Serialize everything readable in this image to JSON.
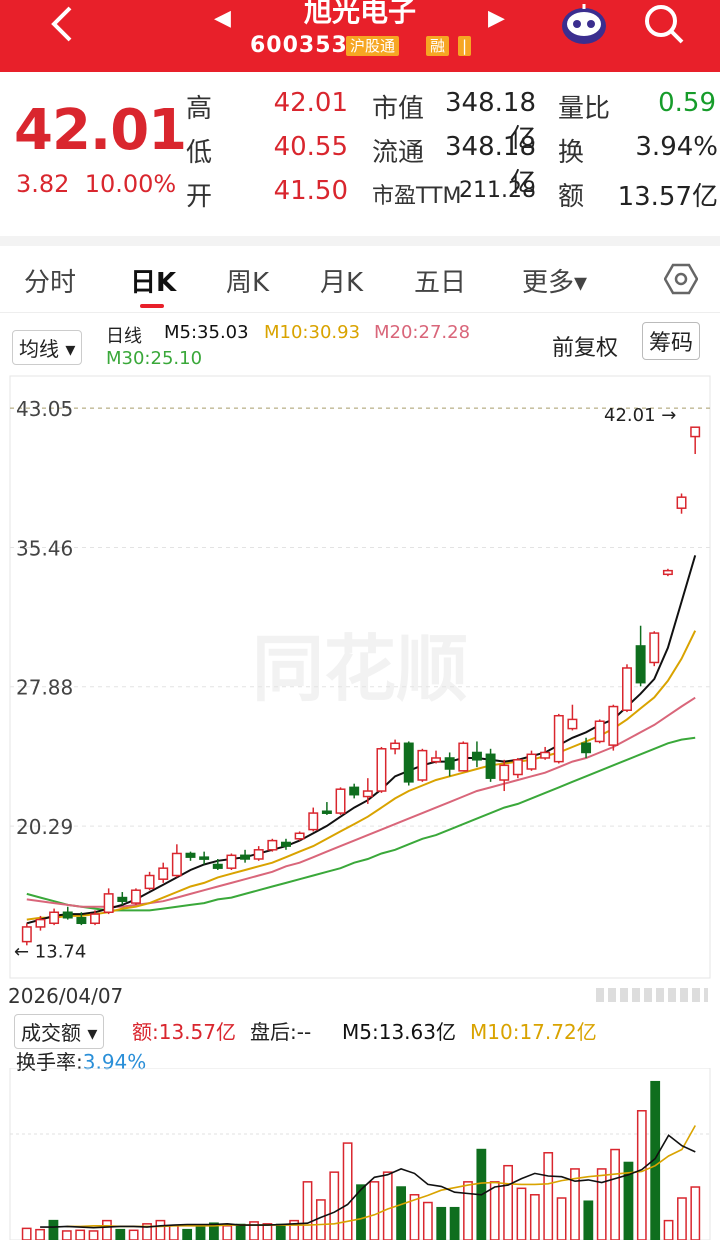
{
  "header": {
    "title": "旭光电子",
    "code": "600353",
    "tag1": "沪股通",
    "tag2": "融",
    "tag3": "|"
  },
  "quote": {
    "price": "42.01",
    "change": "3.82",
    "change_pct": "10.00%",
    "high_label": "高",
    "high": "42.01",
    "low_label": "低",
    "low": "40.55",
    "open_label": "开",
    "open": "41.50",
    "mcap_label": "市值",
    "mcap": "348.18亿",
    "float_label": "流通",
    "float": "348.18亿",
    "pe_label": "市盈TTM",
    "pe": "211.28",
    "vr_label": "量比",
    "vr": "0.59",
    "turn_label": "换",
    "turn": "3.94%",
    "amt_label": "额",
    "amt": "13.57亿"
  },
  "tabs": [
    "分时",
    "日K",
    "周K",
    "月K",
    "五日",
    "更多▾"
  ],
  "indicator": {
    "selector": "均线",
    "period": "日线",
    "m5": "M5:35.03",
    "m10": "M10:30.93",
    "m20": "M20:27.28",
    "m30": "M30:25.10",
    "adjust": "前复权",
    "chips": "筹码"
  },
  "axis": {
    "y_labels": [
      "43.05",
      "35.46",
      "27.88",
      "20.29"
    ],
    "max_label": "42.01",
    "min_label": "13.74",
    "date": "2026/04/07",
    "watermark": "同花顺"
  },
  "volume": {
    "selector": "成交额",
    "amt": "额:13.57亿",
    "after": "盘后:--",
    "m5": "M5:13.63亿",
    "m10": "M10:17.72亿",
    "turn_label": "换手率:",
    "turn": "3.94%"
  },
  "colors": {
    "up": "#d9262e",
    "down": "#0f6e1e",
    "m5": "#111111",
    "m10": "#d9a300",
    "m20": "#d9667a",
    "m30": "#3aa83a"
  },
  "chart_data": {
    "type": "candlestick",
    "y_ticks": [
      43.05,
      35.46,
      27.88,
      20.29
    ],
    "ylim": [
      13.0,
      43.6
    ],
    "candles": [
      {
        "o": 14.0,
        "c": 14.8,
        "h": 15.0,
        "l": 13.8
      },
      {
        "o": 14.8,
        "c": 15.2,
        "h": 15.4,
        "l": 14.6
      },
      {
        "o": 15.0,
        "c": 15.6,
        "h": 15.8,
        "l": 14.9
      },
      {
        "o": 15.6,
        "c": 15.3,
        "h": 15.9,
        "l": 15.2
      },
      {
        "o": 15.3,
        "c": 15.0,
        "h": 15.6,
        "l": 14.9
      },
      {
        "o": 15.0,
        "c": 15.5,
        "h": 15.7,
        "l": 14.9
      },
      {
        "o": 15.6,
        "c": 16.6,
        "h": 16.9,
        "l": 15.5
      },
      {
        "o": 16.4,
        "c": 16.2,
        "h": 16.7,
        "l": 16.0
      },
      {
        "o": 16.1,
        "c": 16.8,
        "h": 16.9,
        "l": 16.0
      },
      {
        "o": 16.9,
        "c": 17.6,
        "h": 17.8,
        "l": 16.8
      },
      {
        "o": 17.4,
        "c": 18.0,
        "h": 18.3,
        "l": 17.2
      },
      {
        "o": 17.6,
        "c": 18.8,
        "h": 19.3,
        "l": 17.5
      },
      {
        "o": 18.8,
        "c": 18.6,
        "h": 18.9,
        "l": 18.4
      },
      {
        "o": 18.6,
        "c": 18.5,
        "h": 18.9,
        "l": 18.2
      },
      {
        "o": 18.2,
        "c": 18.0,
        "h": 18.5,
        "l": 17.9
      },
      {
        "o": 18.0,
        "c": 18.7,
        "h": 18.8,
        "l": 17.9
      },
      {
        "o": 18.7,
        "c": 18.5,
        "h": 19.0,
        "l": 18.3
      },
      {
        "o": 18.5,
        "c": 19.0,
        "h": 19.2,
        "l": 18.4
      },
      {
        "o": 19.0,
        "c": 19.5,
        "h": 19.6,
        "l": 18.9
      },
      {
        "o": 19.4,
        "c": 19.2,
        "h": 19.6,
        "l": 19.0
      },
      {
        "o": 19.6,
        "c": 19.9,
        "h": 20.0,
        "l": 19.5
      },
      {
        "o": 20.1,
        "c": 21.0,
        "h": 21.3,
        "l": 20.0
      },
      {
        "o": 21.1,
        "c": 21.0,
        "h": 21.6,
        "l": 20.9
      },
      {
        "o": 21.0,
        "c": 22.3,
        "h": 22.4,
        "l": 20.9
      },
      {
        "o": 22.4,
        "c": 22.0,
        "h": 22.6,
        "l": 21.8
      },
      {
        "o": 21.9,
        "c": 22.2,
        "h": 22.9,
        "l": 21.5
      },
      {
        "o": 22.2,
        "c": 24.5,
        "h": 24.6,
        "l": 22.1
      },
      {
        "o": 24.5,
        "c": 24.8,
        "h": 25.0,
        "l": 24.2
      },
      {
        "o": 24.8,
        "c": 22.7,
        "h": 24.9,
        "l": 22.5
      },
      {
        "o": 22.8,
        "c": 24.4,
        "h": 24.5,
        "l": 22.7
      },
      {
        "o": 23.8,
        "c": 24.0,
        "h": 24.4,
        "l": 23.7
      },
      {
        "o": 24.0,
        "c": 23.4,
        "h": 24.3,
        "l": 23.0
      },
      {
        "o": 23.3,
        "c": 24.8,
        "h": 24.9,
        "l": 23.3
      },
      {
        "o": 24.3,
        "c": 23.9,
        "h": 24.9,
        "l": 23.5
      },
      {
        "o": 24.2,
        "c": 22.9,
        "h": 24.5,
        "l": 22.7
      },
      {
        "o": 22.8,
        "c": 23.6,
        "h": 23.9,
        "l": 22.2
      },
      {
        "o": 23.1,
        "c": 23.9,
        "h": 24.0,
        "l": 22.9
      },
      {
        "o": 23.4,
        "c": 24.2,
        "h": 24.4,
        "l": 23.3
      },
      {
        "o": 24.0,
        "c": 24.3,
        "h": 24.6,
        "l": 23.9
      },
      {
        "o": 23.8,
        "c": 26.3,
        "h": 26.4,
        "l": 23.7
      },
      {
        "o": 25.6,
        "c": 26.1,
        "h": 26.9,
        "l": 25.5
      },
      {
        "o": 24.8,
        "c": 24.3,
        "h": 25.1,
        "l": 24.0
      },
      {
        "o": 24.9,
        "c": 26.0,
        "h": 26.1,
        "l": 24.8
      },
      {
        "o": 24.7,
        "c": 26.8,
        "h": 26.9,
        "l": 24.4
      },
      {
        "o": 26.6,
        "c": 28.9,
        "h": 29.1,
        "l": 26.5
      },
      {
        "o": 30.1,
        "c": 28.1,
        "h": 31.2,
        "l": 27.9
      },
      {
        "o": 29.2,
        "c": 30.8,
        "h": 30.9,
        "l": 29.0
      },
      {
        "o": 34.0,
        "c": 34.2,
        "h": 34.3,
        "l": 33.9
      },
      {
        "o": 37.6,
        "c": 38.2,
        "h": 38.4,
        "l": 37.3
      },
      {
        "o": 41.5,
        "c": 42.01,
        "h": 42.01,
        "l": 40.55
      }
    ],
    "ma5": [
      15.0,
      15.2,
      15.4,
      15.5,
      15.5,
      15.6,
      15.8,
      16.0,
      16.3,
      16.7,
      17.1,
      17.5,
      17.9,
      18.2,
      18.4,
      18.5,
      18.6,
      18.8,
      19.0,
      19.2,
      19.5,
      19.9,
      20.3,
      20.8,
      21.3,
      21.7,
      22.3,
      23.0,
      23.3,
      23.6,
      23.8,
      23.8,
      24.0,
      24.0,
      23.9,
      23.8,
      23.9,
      24.1,
      24.3,
      24.7,
      25.1,
      25.4,
      25.8,
      26.1,
      26.8,
      27.5,
      28.3,
      30.0,
      32.5,
      35.03
    ],
    "ma10": [
      15.2,
      15.3,
      15.3,
      15.4,
      15.4,
      15.5,
      15.6,
      15.8,
      15.9,
      16.1,
      16.4,
      16.7,
      17.0,
      17.2,
      17.5,
      17.7,
      17.9,
      18.1,
      18.3,
      18.6,
      18.9,
      19.2,
      19.6,
      20.0,
      20.4,
      20.8,
      21.3,
      21.8,
      22.2,
      22.5,
      22.8,
      23.0,
      23.2,
      23.4,
      23.6,
      23.7,
      23.8,
      23.9,
      24.1,
      24.3,
      24.6,
      24.9,
      25.2,
      25.6,
      26.1,
      26.7,
      27.3,
      28.2,
      29.4,
      30.93
    ],
    "ma20": [
      16.3,
      16.2,
      16.1,
      16.0,
      15.9,
      15.9,
      15.9,
      15.9,
      16.0,
      16.1,
      16.2,
      16.4,
      16.6,
      16.8,
      17.0,
      17.2,
      17.4,
      17.6,
      17.8,
      18.1,
      18.3,
      18.6,
      18.9,
      19.2,
      19.5,
      19.8,
      20.1,
      20.4,
      20.7,
      21.0,
      21.3,
      21.6,
      21.9,
      22.2,
      22.4,
      22.6,
      22.8,
      23.0,
      23.2,
      23.5,
      23.8,
      24.0,
      24.3,
      24.6,
      25.0,
      25.4,
      25.8,
      26.3,
      26.8,
      27.28
    ],
    "ma30": [
      16.6,
      16.4,
      16.2,
      16.0,
      15.9,
      15.8,
      15.7,
      15.7,
      15.7,
      15.7,
      15.8,
      15.9,
      16.0,
      16.1,
      16.3,
      16.4,
      16.6,
      16.8,
      17.0,
      17.2,
      17.4,
      17.6,
      17.8,
      18.0,
      18.3,
      18.5,
      18.8,
      19.0,
      19.3,
      19.6,
      19.8,
      20.1,
      20.4,
      20.7,
      21.0,
      21.3,
      21.5,
      21.8,
      22.1,
      22.4,
      22.7,
      23.0,
      23.3,
      23.6,
      23.9,
      24.2,
      24.5,
      24.8,
      25.0,
      25.1
    ],
    "volume": [
      {
        "v": 1.8,
        "up": true
      },
      {
        "v": 1.6,
        "up": true
      },
      {
        "v": 3.0,
        "up": false
      },
      {
        "v": 1.4,
        "up": true
      },
      {
        "v": 1.5,
        "up": true
      },
      {
        "v": 1.4,
        "up": true
      },
      {
        "v": 3.0,
        "up": true
      },
      {
        "v": 1.6,
        "up": false
      },
      {
        "v": 1.5,
        "up": true
      },
      {
        "v": 2.5,
        "up": true
      },
      {
        "v": 3.0,
        "up": true
      },
      {
        "v": 2.2,
        "up": true
      },
      {
        "v": 1.6,
        "up": false
      },
      {
        "v": 2.0,
        "up": false
      },
      {
        "v": 2.6,
        "up": false
      },
      {
        "v": 2.2,
        "up": true
      },
      {
        "v": 2.4,
        "up": false
      },
      {
        "v": 2.8,
        "up": true
      },
      {
        "v": 2.5,
        "up": true
      },
      {
        "v": 2.4,
        "up": false
      },
      {
        "v": 3.0,
        "up": true
      },
      {
        "v": 9.0,
        "up": true
      },
      {
        "v": 6.2,
        "up": true
      },
      {
        "v": 10.5,
        "up": true
      },
      {
        "v": 15.0,
        "up": true
      },
      {
        "v": 8.5,
        "up": false
      },
      {
        "v": 9.0,
        "up": true
      },
      {
        "v": 10.5,
        "up": true
      },
      {
        "v": 8.2,
        "up": false
      },
      {
        "v": 7.0,
        "up": true
      },
      {
        "v": 5.8,
        "up": true
      },
      {
        "v": 5.0,
        "up": false
      },
      {
        "v": 5.0,
        "up": false
      },
      {
        "v": 9.0,
        "up": true
      },
      {
        "v": 14.0,
        "up": false
      },
      {
        "v": 9.0,
        "up": true
      },
      {
        "v": 11.5,
        "up": true
      },
      {
        "v": 8.0,
        "up": true
      },
      {
        "v": 7.0,
        "up": true
      },
      {
        "v": 13.5,
        "up": true
      },
      {
        "v": 6.5,
        "up": true
      },
      {
        "v": 11.0,
        "up": true
      },
      {
        "v": 6.0,
        "up": false
      },
      {
        "v": 11.0,
        "up": true
      },
      {
        "v": 14.0,
        "up": true
      },
      {
        "v": 12.0,
        "up": false
      },
      {
        "v": 20.0,
        "up": true
      },
      {
        "v": 24.5,
        "up": false
      },
      {
        "v": 3.0,
        "up": true
      },
      {
        "v": 6.5,
        "up": true
      },
      {
        "v": 8.2,
        "up": true
      }
    ],
    "vol_ma5": [
      2.0,
      2.0,
      2.1,
      2.0,
      1.9,
      2.0,
      2.1,
      2.1,
      2.0,
      2.2,
      2.3,
      2.4,
      2.4,
      2.4,
      2.5,
      2.3,
      2.3,
      2.3,
      2.4,
      2.5,
      2.6,
      3.5,
      4.3,
      5.5,
      7.8,
      9.7,
      10.1,
      11.0,
      10.3,
      8.6,
      8.3,
      7.4,
      7.2,
      7.0,
      8.2,
      8.5,
      9.5,
      10.3,
      9.9,
      9.8,
      9.1,
      9.3,
      8.9,
      9.5,
      10.1,
      10.9,
      12.6,
      16.2,
      14.6,
      13.63
    ],
    "vol_ma10": [
      2.1,
      2.1,
      2.2,
      2.2,
      2.1,
      2.1,
      2.1,
      2.1,
      2.2,
      2.2,
      2.2,
      2.2,
      2.3,
      2.3,
      2.3,
      2.3,
      2.3,
      2.3,
      2.3,
      2.4,
      2.5,
      2.9,
      3.3,
      3.9,
      4.8,
      5.5,
      6.2,
      6.9,
      7.7,
      8.1,
      8.5,
      8.8,
      8.9,
      8.7,
      8.6,
      8.6,
      8.7,
      9.2,
      9.5,
      9.8,
      10.0,
      10.2,
      10.4,
      10.6,
      11.5,
      13.0,
      14.0,
      17.72
    ]
  }
}
